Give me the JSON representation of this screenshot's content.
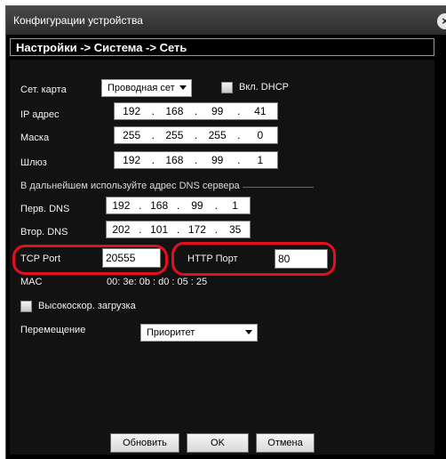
{
  "window": {
    "title": "Конфигурации устройства",
    "close_glyph": "×"
  },
  "breadcrumb": "Настройки -> Система -> Сеть",
  "network_card": {
    "label": "Сет. карта",
    "value": "Проводная сет"
  },
  "dhcp": {
    "label": "Вкл. DHCP",
    "checked": false
  },
  "ip": {
    "label": "IP адрес",
    "octets": [
      "192",
      "168",
      "99",
      "41"
    ]
  },
  "mask": {
    "label": "Маска",
    "octets": [
      "255",
      "255",
      "255",
      "0"
    ]
  },
  "gateway": {
    "label": "Шлюз",
    "octets": [
      "192",
      "168",
      "99",
      "1"
    ]
  },
  "dns_note": "В дальнейшем используйте адрес DNS сервера",
  "dns_primary": {
    "label": "Перв. DNS",
    "octets": [
      "192",
      "168",
      "99",
      "1"
    ]
  },
  "dns_secondary": {
    "label": "Втор. DNS",
    "octets": [
      "202",
      "101",
      "172",
      "35"
    ]
  },
  "tcp_port": {
    "label": "TCP Port",
    "value": "20555"
  },
  "http_port": {
    "label": "HTTP Порт",
    "value": "80"
  },
  "mac": {
    "label": "MAC",
    "value": "00: 3e: 0b : d0 : 05 : 25"
  },
  "high_speed": {
    "label": "Высокоскор. загрузка",
    "checked": false
  },
  "transfer": {
    "label": "Перемещение",
    "value": "Приоритет"
  },
  "buttons": {
    "refresh": "Обновить",
    "ok": "OK",
    "cancel": "Отмена"
  },
  "colors": {
    "highlight": "#e0101e",
    "background": "#121212"
  }
}
